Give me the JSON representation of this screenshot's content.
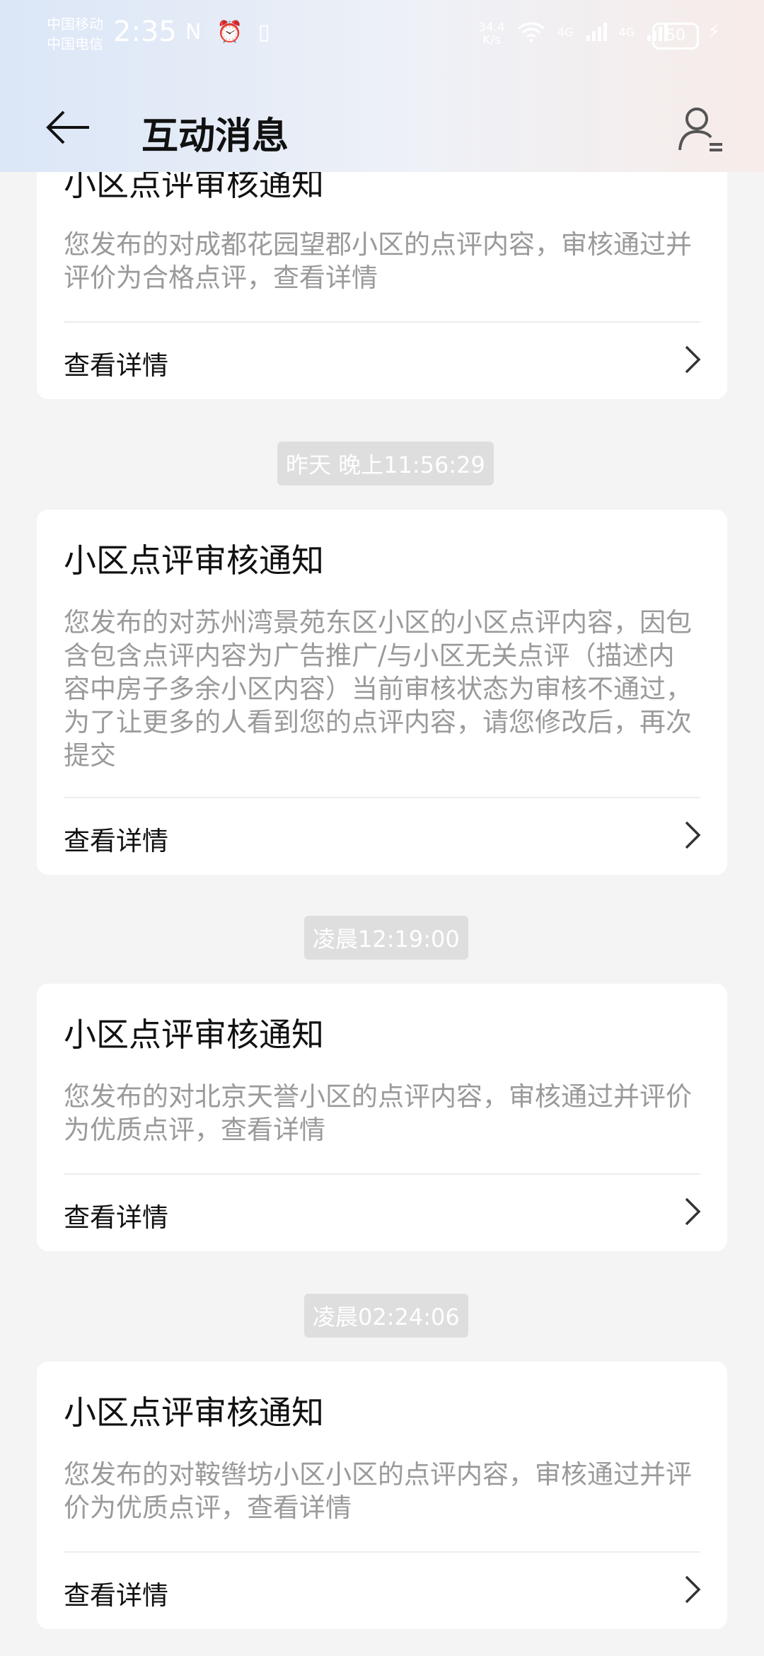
{
  "status_bar": {
    "carrier_1": "中国移动",
    "carrier_2": "中国电信",
    "time": "2:35",
    "icons": "N ⏰ ▯",
    "net_speed_value": "34.4",
    "net_speed_unit": "K/s",
    "net_1": "4G",
    "net_2": "4G",
    "battery": "50"
  },
  "header": {
    "title": "互动消息"
  },
  "messages": [
    {
      "title": "小区点评审核通知",
      "body": "您发布的对成都花园望郡小区的点评内容，审核通过并评价为合格点评，查看详情",
      "action": "查看详情"
    },
    {
      "time": "昨天 晚上11:56:29",
      "title": "小区点评审核通知",
      "body": "您发布的对苏州湾景苑东区小区的小区点评内容，因包含包含点评内容为广告推广/与小区无关点评（描述内容中房子多余小区内容）当前审核状态为审核不通过，为了让更多的人看到您的点评内容，请您修改后，再次提交",
      "action": "查看详情"
    },
    {
      "time": "凌晨12:19:00",
      "title": "小区点评审核通知",
      "body": "您发布的对北京天誉小区的点评内容，审核通过并评价为优质点评，查看详情",
      "action": "查看详情"
    },
    {
      "time": "凌晨02:24:06",
      "title": "小区点评审核通知",
      "body": "您发布的对鞍辔坊小区小区的点评内容，审核通过并评价为优质点评，查看详情",
      "action": "查看详情"
    }
  ],
  "colors": {
    "background": "#f4f4f4",
    "card": "#ffffff",
    "secondary_text": "#9a9a9a",
    "timestamp_chip": "#dedede"
  }
}
